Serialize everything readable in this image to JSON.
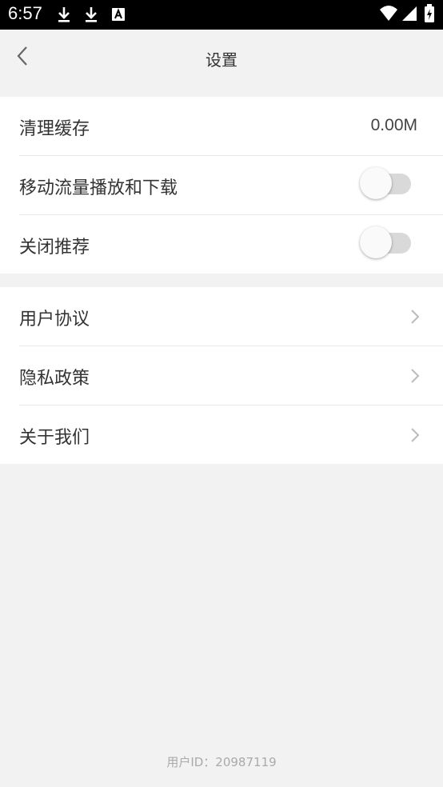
{
  "status_bar": {
    "time": "6:57",
    "icons": [
      "download-icon",
      "download-icon",
      "text-a-icon",
      "wifi-icon",
      "cellular-icon",
      "battery-charging-icon"
    ]
  },
  "header": {
    "title": "设置",
    "back_icon": "chevron-left-icon"
  },
  "settings": {
    "clear_cache": {
      "label": "清理缓存",
      "value": "0.00M"
    },
    "mobile_data": {
      "label": "移动流量播放和下载",
      "enabled": false
    },
    "close_recommend": {
      "label": "关闭推荐",
      "enabled": false
    }
  },
  "links": [
    {
      "label": "用户协议"
    },
    {
      "label": "隐私政策"
    },
    {
      "label": "关于我们"
    }
  ],
  "footer": {
    "user_id": "用户ID：20987119"
  }
}
